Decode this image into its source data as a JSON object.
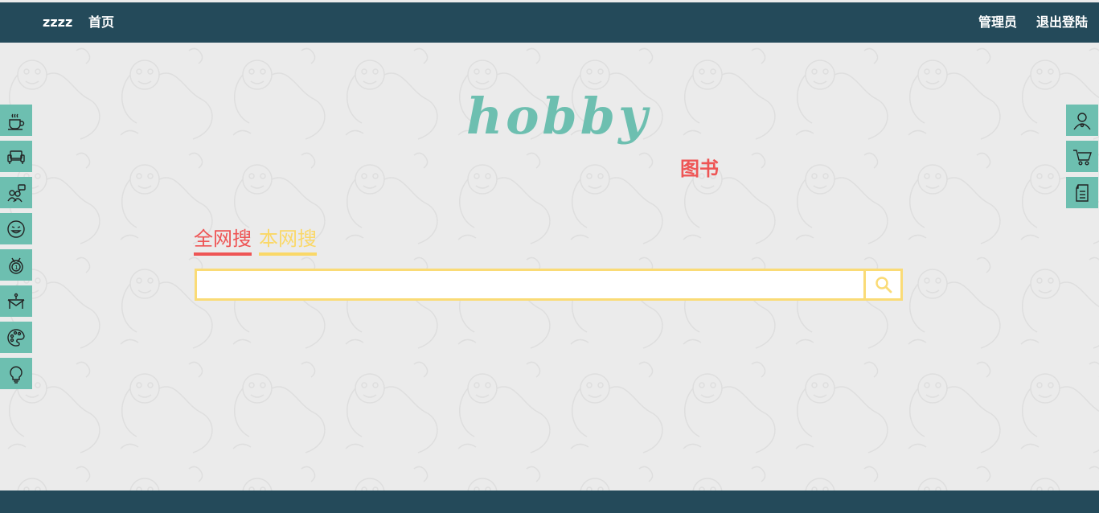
{
  "navbar": {
    "brand": "zzzz",
    "home": "首页",
    "admin": "管理员",
    "logout": "退出登陆"
  },
  "logo": {
    "text": "hobby",
    "color": "#6dbfb0"
  },
  "category": {
    "label": "图书",
    "color": "#ee5555"
  },
  "search": {
    "tabs": [
      {
        "label": "全网搜",
        "color": "#ee5555"
      },
      {
        "label": "本网搜",
        "color": "#fad868"
      }
    ],
    "input_value": "",
    "border_color": "#fadb76",
    "button_icon": "search-icon"
  },
  "left_sidebar": {
    "items": [
      {
        "icon": "coffee-cup-icon"
      },
      {
        "icon": "sofa-icon"
      },
      {
        "icon": "group-chat-icon"
      },
      {
        "icon": "laughing-face-icon"
      },
      {
        "icon": "medal-icon"
      },
      {
        "icon": "table-icon"
      },
      {
        "icon": "palette-icon"
      },
      {
        "icon": "lightbulb-icon"
      }
    ]
  },
  "right_sidebar": {
    "items": [
      {
        "icon": "user-icon"
      },
      {
        "icon": "shopping-cart-icon"
      },
      {
        "icon": "notes-icon"
      }
    ]
  },
  "colors": {
    "navbar": "#244a5a",
    "sidebar": "#6dbfb0",
    "background": "#ebebeb"
  }
}
